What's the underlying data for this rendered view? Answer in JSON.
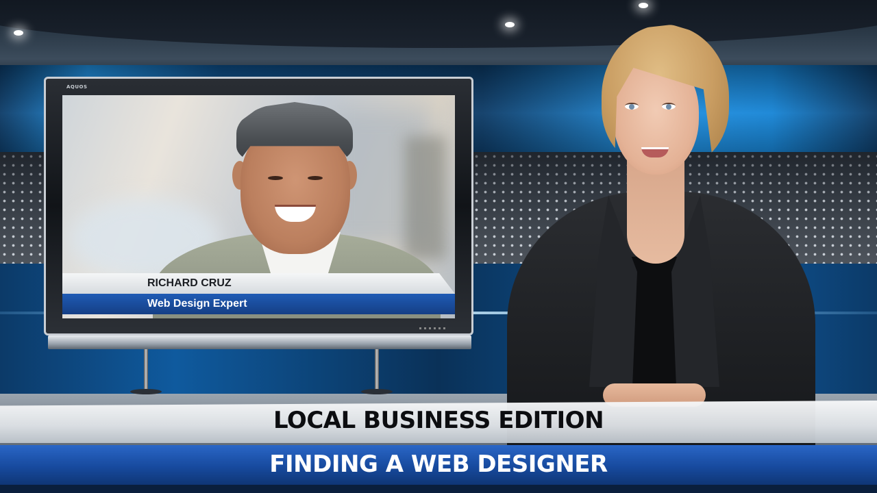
{
  "monitor": {
    "brand": "AQUOS",
    "lower_third": {
      "name": "RICHARD CRUZ",
      "title": "Web Design Expert"
    }
  },
  "banner": {
    "line1": "LOCAL BUSINESS EDITION",
    "line2": "FINDING A WEB DESIGNER"
  },
  "colors": {
    "studio_blue": "#1f8fe0",
    "banner_blue": "#174a9e",
    "banner_silver": "#dde1e5"
  }
}
